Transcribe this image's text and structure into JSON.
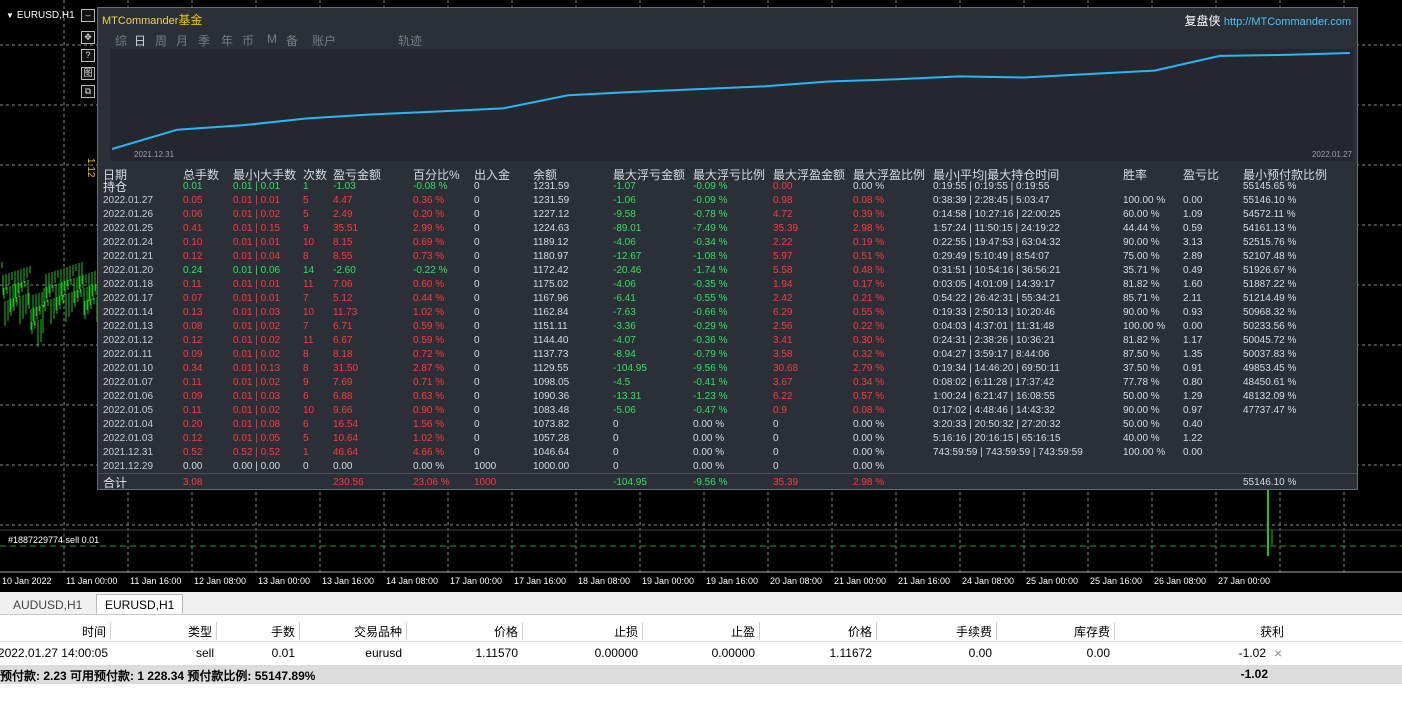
{
  "chart": {
    "symbol_label": "EURUSD,H1",
    "trade_label": "#1887229774 sell 0.01",
    "side_price_label": "1.12",
    "side_buttons": [
      "✥",
      "?",
      "图",
      "⧉"
    ],
    "time_ticks": [
      "10 Jan 2022",
      "11 Jan 00:00",
      "11 Jan 16:00",
      "12 Jan 08:00",
      "13 Jan 00:00",
      "13 Jan 16:00",
      "14 Jan 08:00",
      "17 Jan 00:00",
      "17 Jan 16:00",
      "18 Jan 08:00",
      "19 Jan 00:00",
      "19 Jan 16:00",
      "20 Jan 08:00",
      "21 Jan 00:00",
      "21 Jan 16:00",
      "24 Jan 08:00",
      "25 Jan 00:00",
      "25 Jan 16:00",
      "26 Jan 08:00",
      "27 Jan 00:00"
    ]
  },
  "panel": {
    "title_brand": "MTCommander",
    "title_suffix": "基金",
    "link_label": "复盘侠",
    "link_url": "http://MTCommander.com",
    "tabs": [
      "综",
      "日",
      "周",
      "月",
      "季",
      "年",
      "币",
      "M",
      "备",
      "账户",
      "轨迹"
    ],
    "active_tab": "日",
    "equity_start_label": "2021.12.31",
    "equity_end_label": "2022.01.27",
    "headers": [
      "日期",
      "总手数",
      "最小|大手数",
      "次数",
      "盈亏金额",
      "百分比%",
      "出入金",
      "余额",
      "最大浮亏金额",
      "最大浮亏比例",
      "最大浮盈金额",
      "最大浮盈比例",
      "最小|平均|最大持仓时间",
      "胜率",
      "盈亏比",
      "最小预付款比例"
    ],
    "rows": [
      [
        "持仓",
        "0.01",
        "0.01 | 0.01",
        "1",
        "-1.03",
        "-0.08 %",
        "0",
        "1231.59",
        "-1.07",
        "-0.09 %",
        "0.00",
        "0.00 %",
        "0:19:55 | 0:19:55 | 0:19:55",
        "",
        "",
        "55145.65 %"
      ],
      [
        "2022.01.27",
        "0.05",
        "0.01 | 0.01",
        "5",
        "4.47",
        "0.36 %",
        "0",
        "1231.59",
        "-1.06",
        "-0.09 %",
        "0.98",
        "0.08 %",
        "0:38:39 | 2:28:45 | 5:03:47",
        "100.00 %",
        "0.00",
        "55146.10 %"
      ],
      [
        "2022.01.26",
        "0.06",
        "0.01 | 0.02",
        "5",
        "2.49",
        "0.20 %",
        "0",
        "1227.12",
        "-9.58",
        "-0.78 %",
        "4.72",
        "0.39 %",
        "0:14:58 | 10:27:16 | 22:00:25",
        "60.00 %",
        "1.09",
        "54572.11 %"
      ],
      [
        "2022.01.25",
        "0.41",
        "0.01 | 0.15",
        "9",
        "35.51",
        "2.99 %",
        "0",
        "1224.63",
        "-89.01",
        "-7.49 %",
        "35.39",
        "2.98 %",
        "1:57:24 | 11:50:15 | 24:19:22",
        "44.44 %",
        "0.59",
        "54161.13 %"
      ],
      [
        "2022.01.24",
        "0.10",
        "0.01 | 0.01",
        "10",
        "8.15",
        "0.69 %",
        "0",
        "1189.12",
        "-4.06",
        "-0.34 %",
        "2.22",
        "0.19 %",
        "0:22:55 | 19:47:53 | 63:04:32",
        "90.00 %",
        "3.13",
        "52515.76 %"
      ],
      [
        "2022.01.21",
        "0.12",
        "0.01 | 0.04",
        "8",
        "8.55",
        "0.73 %",
        "0",
        "1180.97",
        "-12.67",
        "-1.08 %",
        "5.97",
        "0.51 %",
        "0:29:49 | 5:10:49 | 8:54:07",
        "75.00 %",
        "2.89",
        "52107.48 %"
      ],
      [
        "2022.01.20",
        "0.24",
        "0.01 | 0.06",
        "14",
        "-2.60",
        "-0.22 %",
        "0",
        "1172.42",
        "-20.46",
        "-1.74 %",
        "5.58",
        "0.48 %",
        "0:31:51 | 10:54:16 | 36:56:21",
        "35.71 %",
        "0.49",
        "51926.67 %"
      ],
      [
        "2022.01.18",
        "0.11",
        "0.01 | 0.01",
        "11",
        "7.06",
        "0.60 %",
        "0",
        "1175.02",
        "-4.06",
        "-0.35 %",
        "1.94",
        "0.17 %",
        "0:03:05 | 4:01:09 | 14:39:17",
        "81.82 %",
        "1.60",
        "51887.22 %"
      ],
      [
        "2022.01.17",
        "0.07",
        "0.01 | 0.01",
        "7",
        "5.12",
        "0.44 %",
        "0",
        "1167.96",
        "-6.41",
        "-0.55 %",
        "2.42",
        "0.21 %",
        "0:54:22 | 26:42:31 | 55:34:21",
        "85.71 %",
        "2.11",
        "51214.49 %"
      ],
      [
        "2022.01.14",
        "0.13",
        "0.01 | 0.03",
        "10",
        "11.73",
        "1.02 %",
        "0",
        "1162.84",
        "-7.63",
        "-0.66 %",
        "6.29",
        "0.55 %",
        "0:19:33 | 2:50:13 | 10:20:46",
        "90.00 %",
        "0.93",
        "50968.32 %"
      ],
      [
        "2022.01.13",
        "0.08",
        "0.01 | 0.02",
        "7",
        "6.71",
        "0.59 %",
        "0",
        "1151.11",
        "-3.36",
        "-0.29 %",
        "2.56",
        "0.22 %",
        "0:04:03 | 4:37:01 | 11:31:48",
        "100.00 %",
        "0.00",
        "50233.56 %"
      ],
      [
        "2022.01.12",
        "0.12",
        "0.01 | 0.02",
        "11",
        "6.67",
        "0.59 %",
        "0",
        "1144.40",
        "-4.07",
        "-0.36 %",
        "3.41",
        "0.30 %",
        "0:24:31 | 2:38:26 | 10:36:21",
        "81.82 %",
        "1.17",
        "50045.72 %"
      ],
      [
        "2022.01.11",
        "0.09",
        "0.01 | 0.02",
        "8",
        "8.18",
        "0.72 %",
        "0",
        "1137.73",
        "-8.94",
        "-0.79 %",
        "3.58",
        "0.32 %",
        "0:04:27 | 3:59:17 | 8:44:06",
        "87.50 %",
        "1.35",
        "50037.83 %"
      ],
      [
        "2022.01.10",
        "0.34",
        "0.01 | 0.13",
        "8",
        "31.50",
        "2.87 %",
        "0",
        "1129.55",
        "-104.95",
        "-9.56 %",
        "30.68",
        "2.79 %",
        "0:19:34 | 14:46:20 | 69:50:11",
        "37.50 %",
        "0.91",
        "49853.45 %"
      ],
      [
        "2022.01.07",
        "0.11",
        "0.01 | 0.02",
        "9",
        "7.69",
        "0.71 %",
        "0",
        "1098.05",
        "-4.5",
        "-0.41 %",
        "3.67",
        "0.34 %",
        "0:08:02 | 6:11:28 | 17:37:42",
        "77.78 %",
        "0.80",
        "48450.61 %"
      ],
      [
        "2022.01.06",
        "0.09",
        "0.01 | 0.03",
        "6",
        "6.88",
        "0.63 %",
        "0",
        "1090.36",
        "-13.31",
        "-1.23 %",
        "6.22",
        "0.57 %",
        "1:00:24 | 6:21:47 | 16:08:55",
        "50.00 %",
        "1.29",
        "48132.09 %"
      ],
      [
        "2022.01.05",
        "0.11",
        "0.01 | 0.02",
        "10",
        "9.66",
        "0.90 %",
        "0",
        "1083.48",
        "-5.06",
        "-0.47 %",
        "0.9",
        "0.08 %",
        "0:17:02 | 4:48:46 | 14:43:32",
        "90.00 %",
        "0.97",
        "47737.47 %"
      ],
      [
        "2022.01.04",
        "0.20",
        "0.01 | 0.08",
        "6",
        "16.54",
        "1.56 %",
        "0",
        "1073.82",
        "0",
        "0.00 %",
        "0",
        "0.00 %",
        "3:20:33 | 20:50:32 | 27:20:32",
        "50.00 %",
        "0.40",
        ""
      ],
      [
        "2022.01.03",
        "0.12",
        "0.01 | 0.05",
        "5",
        "10.64",
        "1.02 %",
        "0",
        "1057.28",
        "0",
        "0.00 %",
        "0",
        "0.00 %",
        "5:16:16 | 20:16:15 | 65:16:15",
        "40.00 %",
        "1.22",
        ""
      ],
      [
        "2021.12.31",
        "0.52",
        "0.52 | 0.52",
        "1",
        "46.64",
        "4.66 %",
        "0",
        "1046.64",
        "0",
        "0.00 %",
        "0",
        "0.00 %",
        "743:59:59 | 743:59:59 | 743:59:59",
        "100.00 %",
        "0.00",
        ""
      ],
      [
        "2021.12.29",
        "0.00",
        "0.00 | 0.00",
        "0",
        "0.00",
        "0.00 %",
        "1000",
        "1000.00",
        "0",
        "0.00 %",
        "0",
        "0.00 %",
        "",
        "",
        "",
        ""
      ]
    ],
    "summary": [
      "合计",
      "3.08",
      "",
      "",
      "230.56",
      "23.06 %",
      "1000",
      "",
      "-104.95",
      "-9.56 %",
      "35.39",
      "2.98 %",
      "",
      "",
      "",
      "55146.10 %"
    ],
    "colors": {
      "gain": "#ff3b3b",
      "loss": "#30e35e",
      "accent": "#f0c000",
      "link": "#4fc3f7",
      "equity_line": "#29b6f6"
    }
  },
  "terminal": {
    "chart_tabs": [
      "AUDUSD,H1",
      "EURUSD,H1"
    ],
    "active_chart_tab": "EURUSD,H1",
    "order_headers": [
      "时间",
      "类型",
      "手数",
      "交易品种",
      "价格",
      "止损",
      "止盈",
      "价格",
      "手续费",
      "库存费",
      "获利"
    ],
    "order_row": [
      "2022.01.27 14:00:05",
      "sell",
      "0.01",
      "eurusd",
      "1.11570",
      "0.00000",
      "0.00000",
      "1.11672",
      "0.00",
      "0.00",
      "-1.02"
    ],
    "balance_text": "预付款: 2.23  可用预付款: 1 228.34  预付款比例: 55147.89%",
    "balance_profit": "-1.02",
    "close_icon": "×"
  }
}
